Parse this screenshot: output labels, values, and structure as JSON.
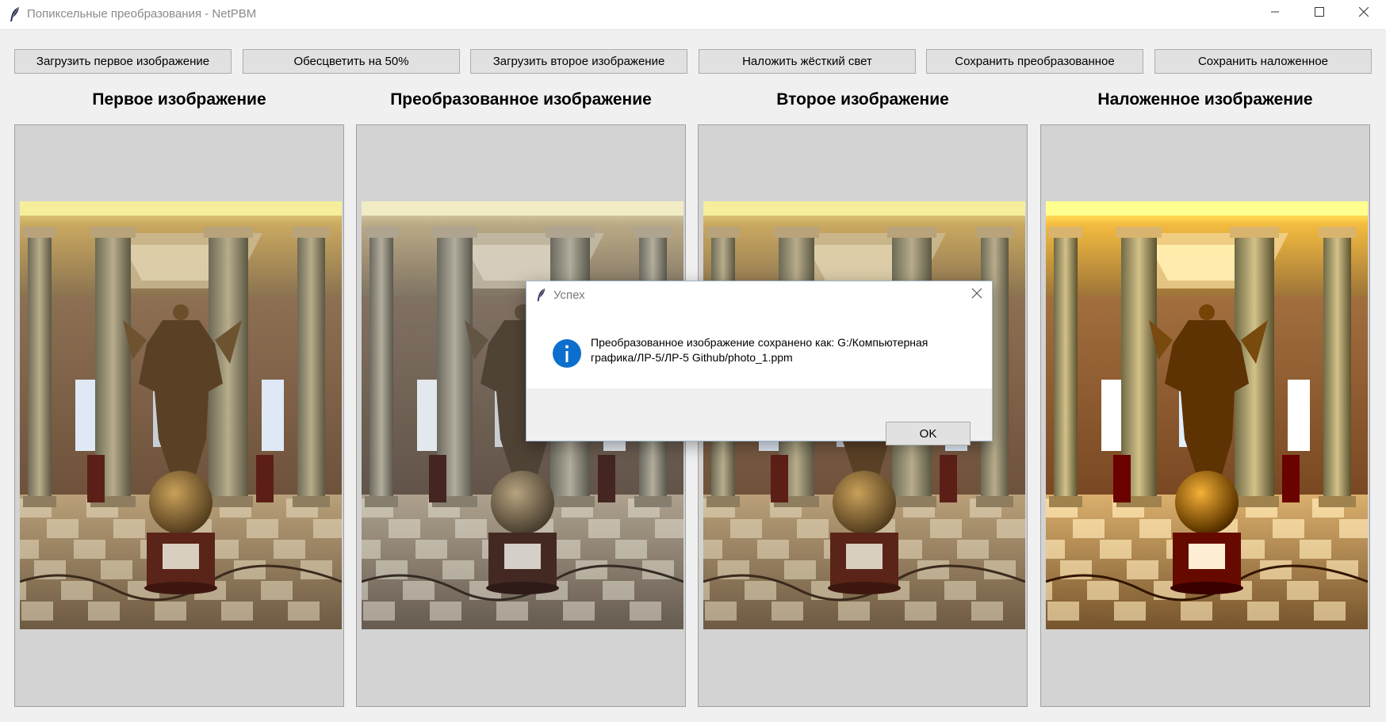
{
  "window": {
    "title": "Попиксельные преобразования - NetPBM",
    "app_icon": "feather-icon",
    "controls": [
      "minimize-icon",
      "maximize-icon",
      "close-icon"
    ]
  },
  "toolbar": {
    "buttons": [
      {
        "label": "Загрузить первое изображение"
      },
      {
        "label": "Обесцветить на 50%"
      },
      {
        "label": "Загрузить второе изображение"
      },
      {
        "label": "Наложить жёсткий свет"
      },
      {
        "label": "Сохранить преобразованное"
      },
      {
        "label": "Сохранить наложенное"
      }
    ]
  },
  "panels": [
    {
      "title": "Первое изображение",
      "tone": "original"
    },
    {
      "title": "Преобразованное изображение",
      "tone": "desaturated"
    },
    {
      "title": "Второе изображение",
      "tone": "original"
    },
    {
      "title": "Наложенное изображение",
      "tone": "hard-light"
    }
  ],
  "dialog": {
    "title": "Успех",
    "icon": "info-icon",
    "message": "Преобразованное изображение сохранено как: G:/Компьютерная графика/ЛР-5/ЛР-5 Github/photo_1.ppm",
    "ok_label": "OK"
  },
  "colors": {
    "window_bg": "#f0f0f0",
    "panel_bg": "#d3d3d3",
    "button_bg": "#e1e1e1",
    "info_blue": "#0c6fce"
  }
}
